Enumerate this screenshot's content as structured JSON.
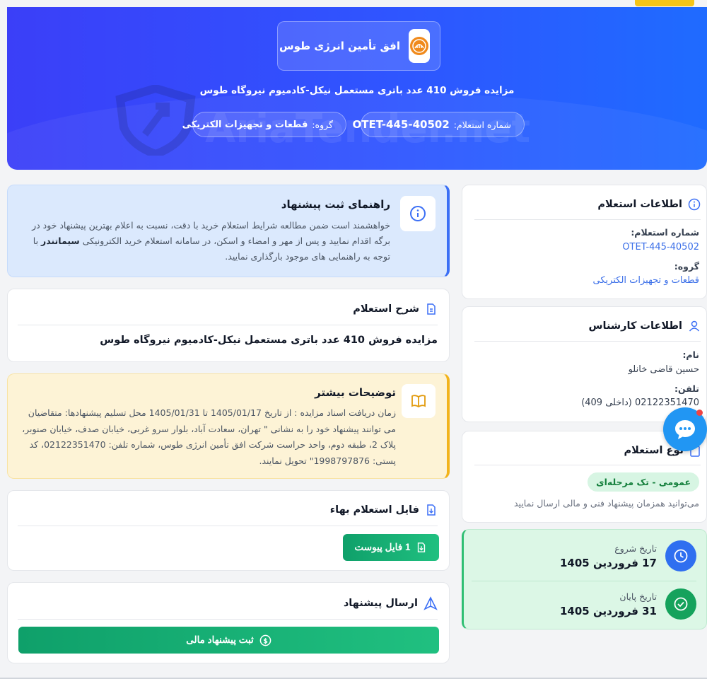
{
  "header": {
    "company_name": "افق تأمین انرژی طوس",
    "title": "مزایده فروش 410 عدد باتری مستعمل نیکل-کادمیوم نیروگاه طوس",
    "code_label": "شماره استعلام:",
    "code_value": "OTET-445-40502",
    "group_label": "گروه:",
    "group_value": "قطعات و تجهیزات الکتریکی",
    "watermark": "AriaTender.net"
  },
  "guide": {
    "title": "راهنمای ثبت پیشنهاد",
    "text_part1": "خواهشمند است ضمن مطالعه شرایط استعلام خرید با دقت، نسبت به اعلام بهترین پیشنهاد خود در برگه اقدام نمایید و پس از مهر و امضاء و اسکن، در سامانه استعلام خرید الکترونیکی ",
    "text_bold": "سیماتندر",
    "text_part2": " با توجه به راهنمایی های موجود بارگذاری نمایید."
  },
  "description": {
    "title": "شرح استعلام",
    "body": "مزایده فروش 410 عدد باتری مستعمل نیکل-کادمیوم نیروگاه طوس"
  },
  "more": {
    "title": "توضیحات بیشتر",
    "text": "زمان دریافت اسناد مزایده : از تاریخ 1405/01/17 تا 1405/01/31 محل تسلیم پیشنهادها: متقاضیان می توانند پیشنهاد خود را به نشانی \" تهران، سعادت آباد، بلوار سرو غربی، خیابان صدف، خیابان صنوبر، پلاک 2، طبقه دوم، واحد حراست شرکت افق تأمین انرژی طوس، شماره تلفن: 02122351470، کد پستی: 1998797876\" تحویل نمایند."
  },
  "file": {
    "title": "فایل استعلام بهاء",
    "button": "1 فایل پیوست"
  },
  "send": {
    "title": "ارسال پیشنهاد",
    "button": "ثبت پیشنهاد مالی"
  },
  "info": {
    "title": "اطلاعات استعلام",
    "code_label": "شماره استعلام:",
    "code_value": "OTET-445-40502",
    "group_label": "گروه:",
    "group_value": "قطعات و تجهیزات الکتریکی"
  },
  "expert": {
    "title": "اطلاعات کارشناس",
    "name_label": "نام:",
    "name_value": "حسین قاضی خانلو",
    "phone_label": "تلفن:",
    "phone_value": "02122351470 (داخلی 409)"
  },
  "type": {
    "title": "نوع استعلام",
    "badge": "عمومی - تک مرحله‌ای",
    "note": "می‌توانید همزمان پیشنهاد فنی و مالی ارسال نمایید"
  },
  "dates": {
    "start_label": "تاریخ شروع",
    "start_value": "17 فروردین 1405",
    "end_label": "تاریخ پایان",
    "end_value": "31 فروردین 1405"
  },
  "colors": {
    "hero_start": "#3b3ff8",
    "hero_end": "#1f6bff",
    "accent_green": "#0fa06a",
    "link_blue": "#3b6fe8"
  }
}
